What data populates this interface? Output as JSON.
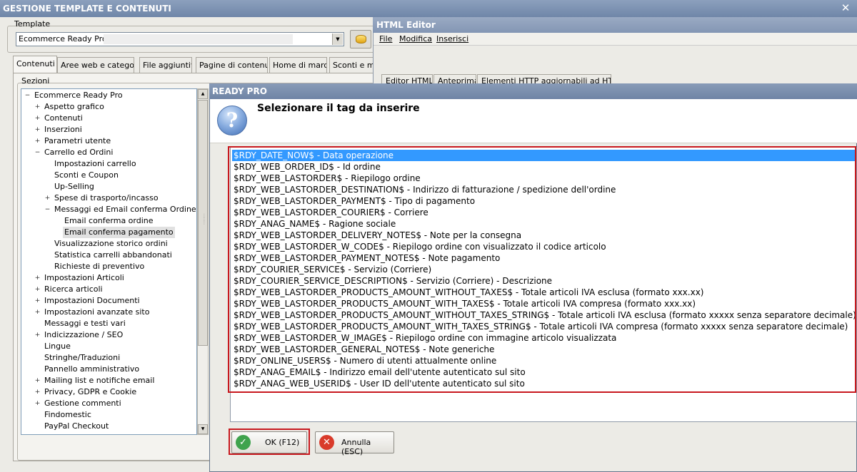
{
  "main_window": {
    "title": "GESTIONE TEMPLATE E CONTENUTI",
    "close_glyph": "✕",
    "template_label": "Template",
    "template_value": "Ecommerce Ready Pro",
    "tabs": [
      "Contenuti",
      "Aree web e categorie",
      "File aggiuntivi",
      "Pagine di contenuti",
      "Home di marca",
      "Sconti e ma"
    ],
    "sections_label": "Sezioni"
  },
  "tree": [
    {
      "label": "Ecommerce Ready Pro",
      "level": 0,
      "expander": "minus"
    },
    {
      "label": "Aspetto grafico",
      "level": 1,
      "expander": "plus"
    },
    {
      "label": "Contenuti",
      "level": 1,
      "expander": "plus"
    },
    {
      "label": "Inserzioni",
      "level": 1,
      "expander": "plus"
    },
    {
      "label": "Parametri utente",
      "level": 1,
      "expander": "plus"
    },
    {
      "label": "Carrello ed Ordini",
      "level": 1,
      "expander": "minus"
    },
    {
      "label": "Impostazioni carrello",
      "level": 2,
      "expander": ""
    },
    {
      "label": "Sconti e Coupon",
      "level": 2,
      "expander": ""
    },
    {
      "label": "Up-Selling",
      "level": 2,
      "expander": ""
    },
    {
      "label": "Spese di trasporto/incasso",
      "level": 2,
      "expander": "plus"
    },
    {
      "label": "Messaggi ed Email conferma Ordine",
      "level": 2,
      "expander": "minus"
    },
    {
      "label": "Email conferma ordine",
      "level": 3,
      "expander": ""
    },
    {
      "label": "Email conferma pagamento",
      "level": 3,
      "expander": "",
      "selected": true
    },
    {
      "label": "Visualizzazione storico ordini",
      "level": 2,
      "expander": ""
    },
    {
      "label": "Statistica carrelli abbandonati",
      "level": 2,
      "expander": ""
    },
    {
      "label": "Richieste di preventivo",
      "level": 2,
      "expander": ""
    },
    {
      "label": "Impostazioni Articoli",
      "level": 1,
      "expander": "plus"
    },
    {
      "label": "Ricerca articoli",
      "level": 1,
      "expander": "plus"
    },
    {
      "label": "Impostazioni Documenti",
      "level": 1,
      "expander": "plus"
    },
    {
      "label": "Impostazioni avanzate sito",
      "level": 1,
      "expander": "plus"
    },
    {
      "label": "Messaggi e testi vari",
      "level": 1,
      "expander": ""
    },
    {
      "label": "Indicizzazione / SEO",
      "level": 1,
      "expander": "plus"
    },
    {
      "label": "Lingue",
      "level": 1,
      "expander": ""
    },
    {
      "label": "Stringhe/Traduzioni",
      "level": 1,
      "expander": ""
    },
    {
      "label": "Pannello amministrativo",
      "level": 1,
      "expander": ""
    },
    {
      "label": "Mailing list e notifiche email",
      "level": 1,
      "expander": "plus"
    },
    {
      "label": "Privacy, GDPR e Cookie",
      "level": 1,
      "expander": "plus"
    },
    {
      "label": "Gestione commenti",
      "level": 1,
      "expander": "plus"
    },
    {
      "label": "Findomestic",
      "level": 1,
      "expander": ""
    },
    {
      "label": "PayPal Checkout",
      "level": 1,
      "expander": ""
    }
  ],
  "editor": {
    "title": "HTML Editor",
    "menu": [
      "File",
      "Modifica",
      "Inserisci"
    ],
    "tabs": [
      "Editor HTML",
      "Anteprima",
      "Elementi HTTP aggiornabili ad HTTPS"
    ]
  },
  "dialog": {
    "title": "READY PRO",
    "icon": "question-icon",
    "prompt": "Selezionare il tag da inserire",
    "tags": [
      "$RDY_DATE_NOW$ - Data operazione",
      "$RDY_WEB_ORDER_ID$ - Id ordine",
      "$RDY_WEB_LASTORDER$ - Riepilogo ordine",
      "$RDY_WEB_LASTORDER_DESTINATION$ - Indirizzo di fatturazione / spedizione dell'ordine",
      "$RDY_WEB_LASTORDER_PAYMENT$ - Tipo di pagamento",
      "$RDY_WEB_LASTORDER_COURIER$ - Corriere",
      "$RDY_ANAG_NAME$ - Ragione sociale",
      "$RDY_WEB_LASTORDER_DELIVERY_NOTES$ - Note per la consegna",
      "$RDY_WEB_LASTORDER_W_CODE$ - Riepilogo ordine con visualizzato il codice articolo",
      "$RDY_WEB_LASTORDER_PAYMENT_NOTES$ - Note pagamento",
      "$RDY_COURIER_SERVICE$ - Servizio (Corriere)",
      "$RDY_COURIER_SERVICE_DESCRIPTION$ - Servizio (Corriere) - Descrizione",
      "$RDY_WEB_LASTORDER_PRODUCTS_AMOUNT_WITHOUT_TAXES$ - Totale articoli IVA esclusa (formato xxx.xx)",
      "$RDY_WEB_LASTORDER_PRODUCTS_AMOUNT_WITH_TAXES$ - Totale articoli IVA compresa (formato xxx.xx)",
      "$RDY_WEB_LASTORDER_PRODUCTS_AMOUNT_WITHOUT_TAXES_STRING$ - Totale articoli IVA esclusa (formato xxxxx senza separatore decimale)",
      "$RDY_WEB_LASTORDER_PRODUCTS_AMOUNT_WITH_TAXES_STRING$ - Totale articoli IVA compresa (formato xxxxx senza separatore decimale)",
      "$RDY_WEB_LASTORDER_W_IMAGE$ - Riepilogo ordine con immagine articolo visualizzata",
      "$RDY_WEB_LASTORDER_GENERAL_NOTES$ - Note generiche",
      "$RDY_ONLINE_USERS$ - Numero di utenti attualmente online",
      "$RDY_ANAG_EMAIL$ - Indirizzo email dell'utente autenticato sul sito",
      "$RDY_ANAG_WEB_USERID$ - User ID dell'utente autenticato sul sito"
    ],
    "selected_index": 0,
    "ok_label": "OK (F12)",
    "cancel_label": "Annulla (ESC)",
    "ok_icon": "check-icon",
    "cancel_icon": "cancel-icon"
  },
  "colors": {
    "selection": "#3399ff",
    "highlight_frame": "#c8181e",
    "ok_icon": "#3fa34d",
    "cancel_icon": "#d93b2b"
  }
}
